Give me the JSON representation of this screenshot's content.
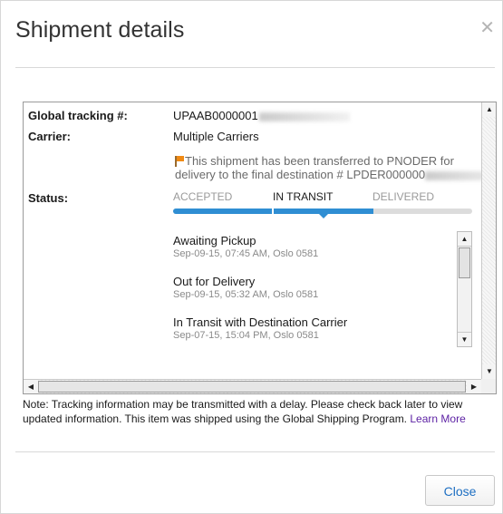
{
  "dialog": {
    "title": "Shipment details",
    "close_icon": "close-icon"
  },
  "details": {
    "tracking_label": "Global tracking #:",
    "tracking_value": "UPAAB0000001",
    "carrier_label": "Carrier:",
    "carrier_value": "Multiple Carriers",
    "notice_line1": "This shipment has been transferred to PNODER for",
    "notice_line2": "delivery to the final destination # LPDER000000",
    "status_label": "Status:"
  },
  "status": {
    "steps": [
      "ACCEPTED",
      "IN TRANSIT",
      "DELIVERED"
    ],
    "current_index": 1,
    "progress_fraction": 0.67
  },
  "events": [
    {
      "title": "Awaiting Pickup",
      "meta": "Sep-09-15, 07:45 AM, Oslo 0581"
    },
    {
      "title": "Out for Delivery",
      "meta": "Sep-09-15, 05:32 AM, Oslo 0581"
    },
    {
      "title": "In Transit with Destination Carrier",
      "meta": "Sep-07-15, 15:04 PM, Oslo 0581"
    }
  ],
  "note": {
    "text": "Note: Tracking information may be transmitted with a delay. Please check back later to view updated information. This item was shipped using the Global Shipping Program.",
    "link": "Learn More"
  },
  "footer": {
    "close_label": "Close"
  },
  "colors": {
    "accent": "#2f8ed3",
    "link": "#5b1fa3",
    "flag": "#f08a14"
  }
}
